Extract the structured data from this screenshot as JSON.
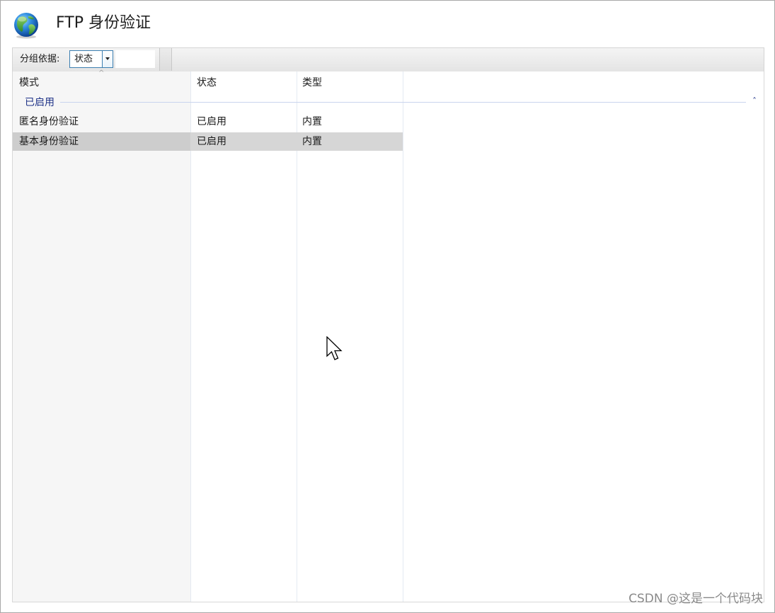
{
  "header": {
    "title": "FTP 身份验证",
    "icon": "globe-icon"
  },
  "toolbar": {
    "group_by_label": "分组依据:",
    "group_by_value": "状态",
    "dropdown_icon": "chevron-down-icon"
  },
  "list": {
    "columns": [
      {
        "label": "模式",
        "sorted": "ascending"
      },
      {
        "label": "状态"
      },
      {
        "label": "类型"
      }
    ],
    "groups": [
      {
        "label": "已启用",
        "collapse_icon": "chevron-up-icon",
        "rows": [
          {
            "mode": "匿名身份验证",
            "status": "已启用",
            "type": "内置",
            "selected": false
          },
          {
            "mode": "基本身份验证",
            "status": "已启用",
            "type": "内置",
            "selected": true
          }
        ]
      }
    ]
  },
  "colors": {
    "group_header_text": "#1e3287",
    "selected_row": "#d6d6d6",
    "select_border": "#3c7fb1"
  },
  "watermark": "CSDN @这是一个代码块"
}
